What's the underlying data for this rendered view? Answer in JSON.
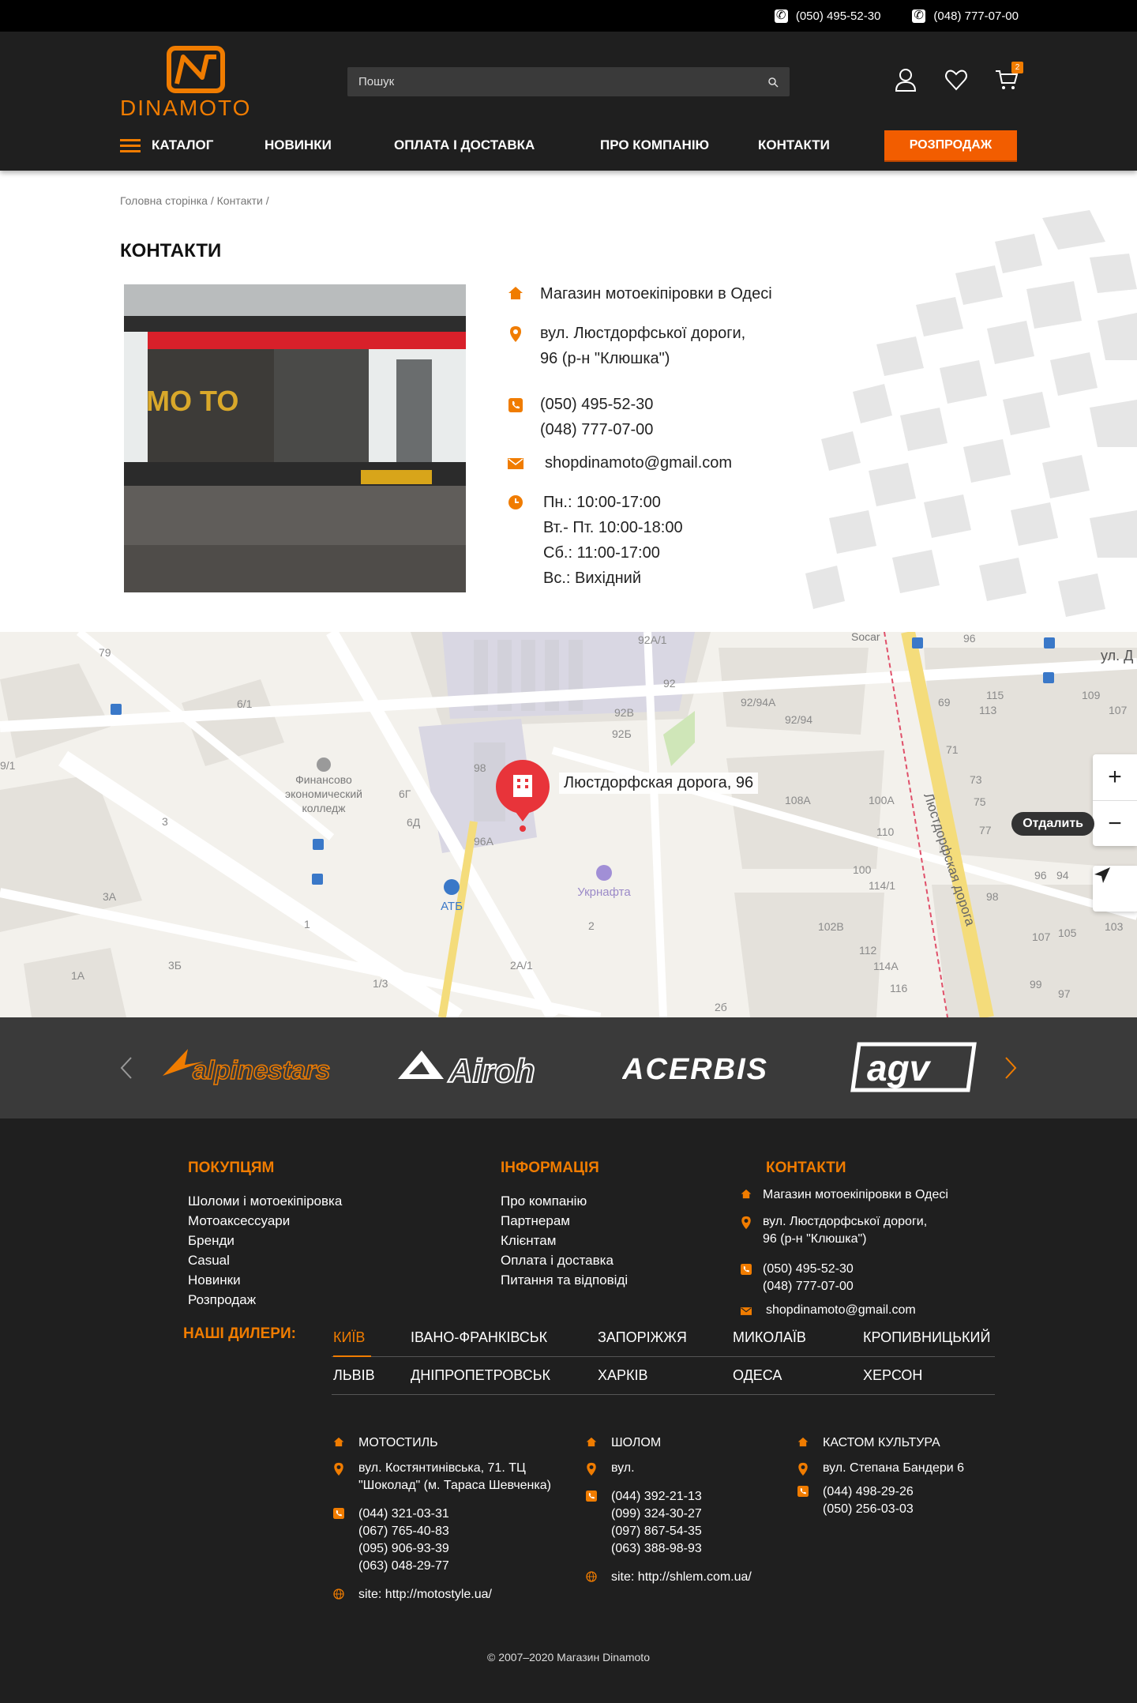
{
  "topbar": {
    "phone1": "(050) 495-52-30",
    "phone2": "(048) 777-07-00"
  },
  "header": {
    "logo_text": "DINAMOTO",
    "search_placeholder": "Пошук",
    "cart_count": "2",
    "nav": {
      "catalog": "КАТАЛОГ",
      "news": "НОВИНКИ",
      "payment": "ОПЛАТА І ДОСТАВКА",
      "about": "ПРО КОМПАНІЮ",
      "contacts": "КОНТАКТИ",
      "sale": "РОЗПРОДАЖ"
    }
  },
  "breadcrumb": "Головна сторінка / Контакти /",
  "page_title": "КОНТАКТИ",
  "contacts": {
    "shop": "Магазин мотоекіпіровки в Одесі",
    "address1": "вул. Люстдорфської дороги,",
    "address2": "96 (р-н \"Клюшка\")",
    "phone1": "(050) 495-52-30",
    "phone2": "(048) 777-07-00",
    "email": "shopdinamoto@gmail.com",
    "hours": [
      "Пн.:  10:00-17:00",
      "Вт.- Пт. 10:00-18:00",
      "Сб.:  11:00-17:00",
      "Вс.: Вихідний"
    ]
  },
  "map": {
    "pin_label": "Люстдорфская дорога, 96",
    "zoom_in": "+",
    "zoom_out": "−",
    "tooltip": "Отдалить",
    "labels": {
      "college": "Финансово экономический колледж",
      "atb": "АТБ",
      "ukrnafta": "Укрнафта",
      "street": "Люстдорфская дорога",
      "street_top": "ул. Д",
      "socar": "Socar"
    }
  },
  "brands": [
    "alpinestars",
    "Airoh",
    "ACERBIS",
    "agv"
  ],
  "footer": {
    "buyers": {
      "title": "ПОКУПЦЯМ",
      "links": [
        "Шоломи і мотоекіпіровка",
        "Мотоаксессуари",
        "Бренди",
        "Casual",
        "Новинки",
        "Розпродаж"
      ]
    },
    "info": {
      "title": "ІНФОРМАЦІЯ",
      "links": [
        "Про компанію",
        "Партнерам",
        "Клієнтам",
        "Оплата і доставка",
        "Питання та відповіді"
      ]
    },
    "contacts": {
      "title": "КОНТАКТИ",
      "shop": "Магазин мотоекіпіровки в Одесі",
      "address1": "вул. Люстдорфської дороги,",
      "address2": "96 (р-н \"Клюшка\")",
      "phone1": "(050) 495-52-30",
      "phone2": "(048) 777-07-00",
      "email": "shopdinamoto@gmail.com"
    },
    "dealers_title": "НАШІ ДИЛЕРИ:",
    "cities_row1": [
      "КИЇВ",
      "ІВАНО-ФРАНКІВСЬК",
      "ЗАПОРІЖЖЯ",
      "МИКОЛАЇВ",
      "КРОПИВНИЦЬКИЙ"
    ],
    "cities_row2": [
      "ЛЬВІВ",
      "ДНІПРОПЕТРОВСЬК",
      "ХАРКІВ",
      "ОДЕСА",
      "ХЕРСОН"
    ],
    "dealers": [
      {
        "name": "МОТОСТИЛЬ",
        "address1": "вул. Костянтинівська, 71. ТЦ",
        "address2": "\"Шоколад\" (м. Тараса Шевченка)",
        "phones": [
          "(044) 321-03-31",
          "(067) 765-40-83",
          "(095) 906-93-39",
          "(063) 048-29-77"
        ],
        "site": "site: http://motostyle.ua/"
      },
      {
        "name": "ШОЛОМ",
        "address1": "вул.",
        "address2": "",
        "phones": [
          "(044) 392-21-13",
          "(099) 324-30-27",
          "(097) 867-54-35",
          "(063) 388-98-93"
        ],
        "site": "site: http://shlem.com.ua/"
      },
      {
        "name": "КАСТОМ КУЛЬТУРА",
        "address1": "вул. Степана Бандери 6",
        "address2": "",
        "phones": [
          "(044) 498-29-26",
          "(050) 256-03-03"
        ],
        "site": ""
      }
    ],
    "copyright": "© 2007–2020 Магазин Dinamoto"
  },
  "colors": {
    "accent": "#f07c00",
    "header_bg": "#1f1f1f",
    "topbar_bg": "#000000",
    "sale": "#f25d00"
  }
}
